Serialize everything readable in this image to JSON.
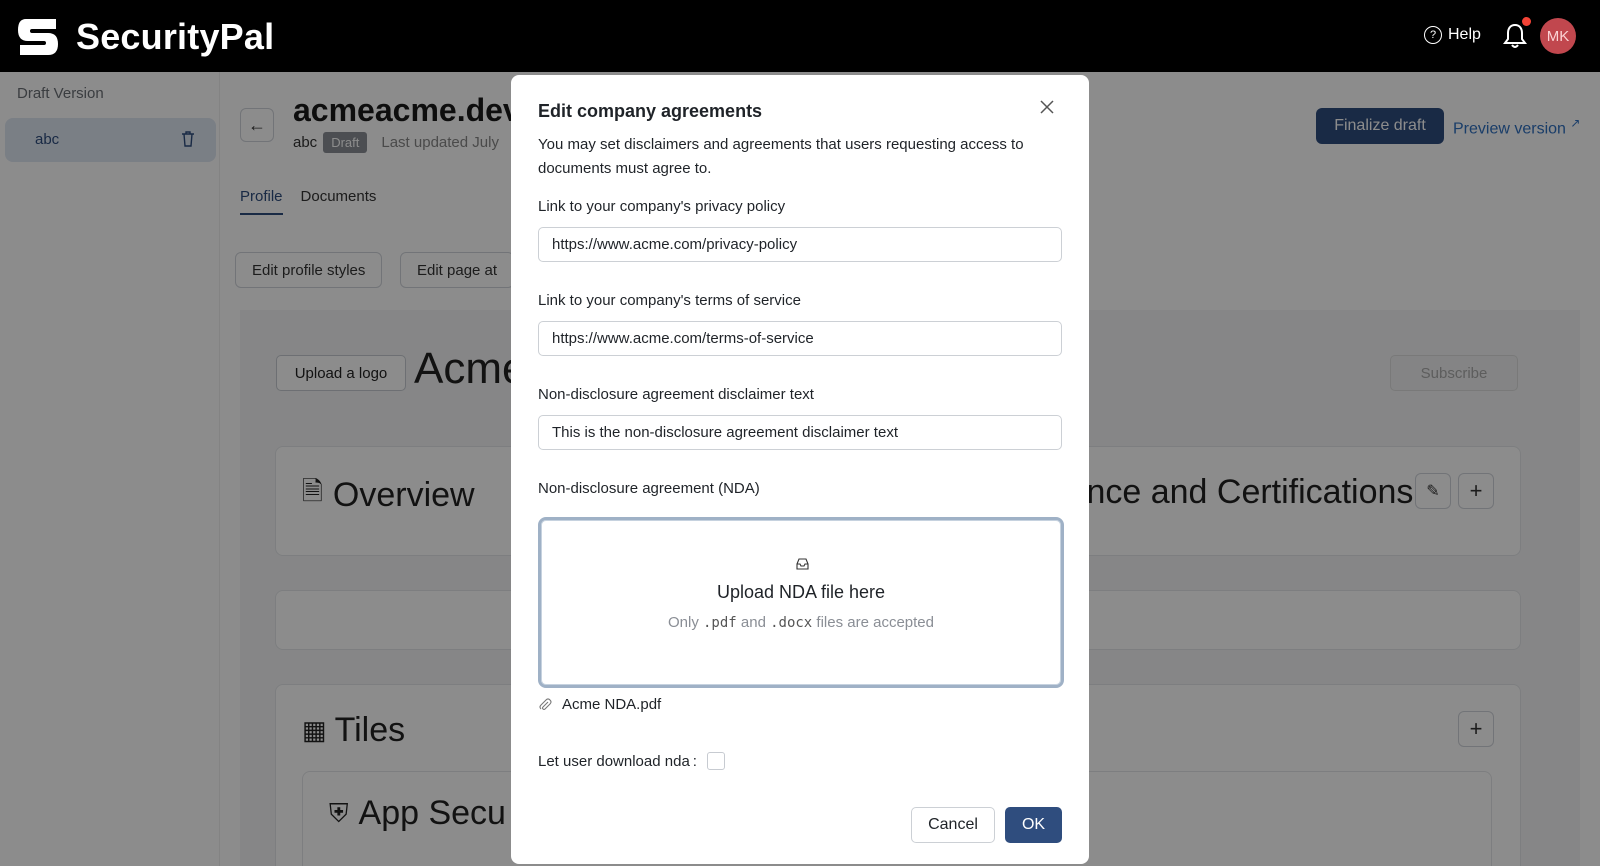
{
  "app": {
    "brand": "SecurityPal",
    "help_label": "Help",
    "avatar_initials": "MK",
    "brand_color": "#000000",
    "accent_color": "#2f4d7e"
  },
  "sidebar": {
    "heading": "Draft Version",
    "items": [
      {
        "label": "abc",
        "icon": "trash-icon"
      }
    ]
  },
  "profile": {
    "title": "acmeacme.dev",
    "subtitle": "abc",
    "badge": "Draft",
    "last_updated": "Last updated July",
    "tabs": [
      {
        "label": "Profile",
        "active": true
      },
      {
        "label": "Documents",
        "active": false
      }
    ],
    "edit_profile_styles": "Edit profile styles",
    "edit_page_attrs": "Edit page at",
    "finalize_label": "Finalize draft",
    "preview_label": "Preview version",
    "upload_logo_label": "Upload a logo",
    "company_name": "Acme",
    "subscribe_label": "Subscribe",
    "overview_title": "Overview",
    "compliance_title": "iance and Certifications",
    "tiles_title": "Tiles",
    "app_security_title": "App Secu"
  },
  "modal": {
    "title": "Edit company agreements",
    "description": "You may set disclaimers and agreements that users requesting access to documents must agree to.",
    "privacy_label": "Link to your company's privacy policy",
    "privacy_value": "https://www.acme.com/privacy-policy",
    "terms_label": "Link to your company's terms of service",
    "terms_value": "https://www.acme.com/terms-of-service",
    "nda_disclaimer_label": "Non-disclosure agreement disclaimer text",
    "nda_disclaimer_value": "This is the non-disclosure agreement disclaimer text",
    "nda_label": "Non-disclosure agreement (NDA)",
    "dropzone_title": "Upload NDA file here",
    "dropzone_hint_prefix": "Only",
    "dropzone_ext_pdf": ".pdf",
    "dropzone_hint_and": "and",
    "dropzone_ext_docx": ".docx",
    "dropzone_hint_suffix": "files are accepted",
    "attachment_name": "Acme NDA.pdf",
    "download_label": "Let user download nda",
    "download_colon": ":",
    "download_checked": false,
    "cancel_label": "Cancel",
    "ok_label": "OK"
  }
}
